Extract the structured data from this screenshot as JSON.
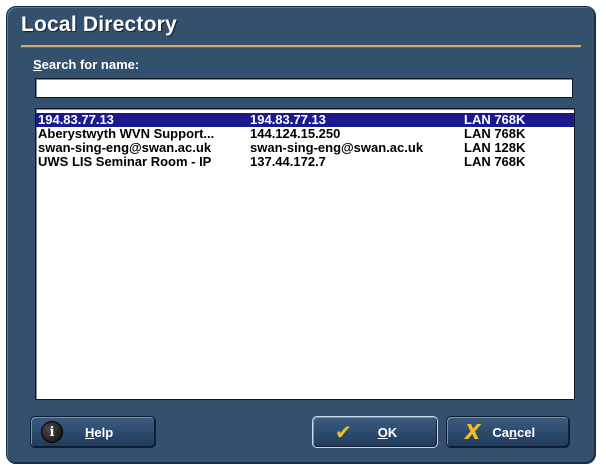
{
  "window": {
    "title": "Local Directory"
  },
  "search": {
    "label_accel": "S",
    "label_rest": "earch for name:",
    "value": ""
  },
  "entries": [
    {
      "name": "194.83.77.13",
      "address": "194.83.77.13",
      "speed": "LAN 768K"
    },
    {
      "name": "Aberystwyth WVN Support...",
      "address": "144.124.15.250",
      "speed": "LAN 768K"
    },
    {
      "name": "swan-sing-eng@swan.ac.uk",
      "address": "swan-sing-eng@swan.ac.uk",
      "speed": "LAN 128K"
    },
    {
      "name": "UWS LIS Seminar Room - IP",
      "address": "137.44.172.7",
      "speed": "LAN 768K"
    }
  ],
  "selected_index": 0,
  "buttons": {
    "help": {
      "accel": "H",
      "rest": "elp",
      "icon": "info-icon"
    },
    "ok": {
      "accel": "O",
      "rest": "K",
      "icon": "checkmark-icon"
    },
    "cancel": {
      "pre": "Ca",
      "accel": "n",
      "rest": "cel",
      "icon": "x-icon"
    }
  },
  "colors": {
    "dialog_bg": "#34506f",
    "title_rule": "#d4a86a",
    "selection": "#1a1a8e",
    "icon_accent": "#f0c020"
  }
}
